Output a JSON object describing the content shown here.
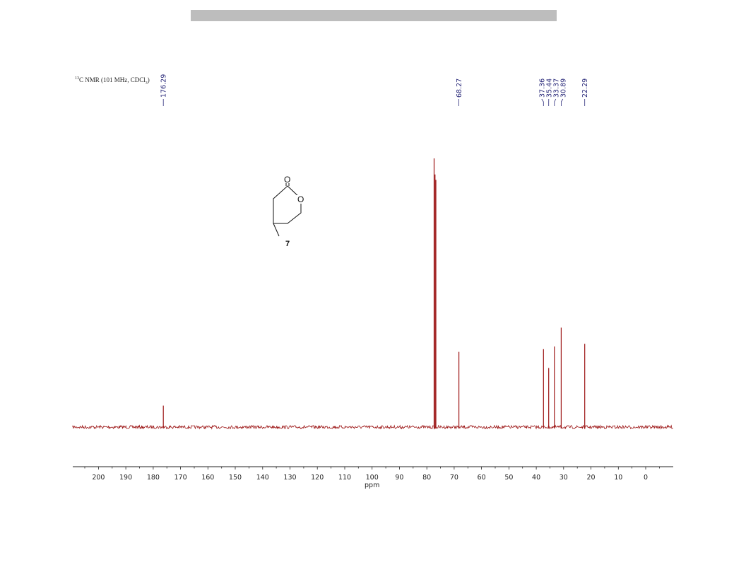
{
  "header": {
    "isotope": "13",
    "nmr_prefix": "C NMR (101 MHz, CDCl",
    "solvent_sub": "3",
    "nmr_suffix": ")"
  },
  "compound": {
    "number": "7",
    "atoms": [
      "O",
      "O"
    ]
  },
  "colors": {
    "spectrum": "#9c1515",
    "peak_label": "#2a2a7a",
    "top_bar": "#bdbdbd"
  },
  "chart_data": {
    "type": "line",
    "title": "",
    "xlabel": "ppm",
    "ylabel": "",
    "x_reversed": true,
    "xlim": [
      220,
      -10
    ],
    "ylim": [
      0,
      1
    ],
    "x_ticks": [
      {
        "value": 200,
        "label": "200"
      },
      {
        "value": 190,
        "label": "190"
      },
      {
        "value": 180,
        "label": "180"
      },
      {
        "value": 170,
        "label": "170"
      },
      {
        "value": 160,
        "label": "160"
      },
      {
        "value": 150,
        "label": "150"
      },
      {
        "value": 140,
        "label": "140"
      },
      {
        "value": 130,
        "label": "130"
      },
      {
        "value": 120,
        "label": "120"
      },
      {
        "value": 110,
        "label": "110"
      },
      {
        "value": 100,
        "label": "100"
      },
      {
        "value": 90,
        "label": "90"
      },
      {
        "value": 80,
        "label": "80"
      },
      {
        "value": 70,
        "label": "70"
      },
      {
        "value": 60,
        "label": "60"
      },
      {
        "value": 50,
        "label": "50"
      },
      {
        "value": 40,
        "label": "40"
      },
      {
        "value": 30,
        "label": "30"
      },
      {
        "value": 20,
        "label": "20"
      },
      {
        "value": 10,
        "label": "10"
      },
      {
        "value": 0,
        "label": "0"
      }
    ],
    "peaks": [
      {
        "ppm": 176.29,
        "intensity": 0.08
      },
      {
        "ppm": 77.32,
        "intensity": 1.0
      },
      {
        "ppm": 77.0,
        "intensity": 0.94
      },
      {
        "ppm": 76.68,
        "intensity": 0.92
      },
      {
        "ppm": 68.27,
        "intensity": 0.28
      },
      {
        "ppm": 37.36,
        "intensity": 0.29
      },
      {
        "ppm": 35.44,
        "intensity": 0.22
      },
      {
        "ppm": 33.37,
        "intensity": 0.3
      },
      {
        "ppm": 30.89,
        "intensity": 0.37
      },
      {
        "ppm": 22.29,
        "intensity": 0.31
      }
    ],
    "peak_labels": [
      {
        "ppm": 176.29,
        "text": "176.29"
      },
      {
        "ppm": 68.27,
        "text": "68.27"
      },
      {
        "ppm": 37.36,
        "text": "37.36"
      },
      {
        "ppm": 35.44,
        "text": "35.44"
      },
      {
        "ppm": 33.37,
        "text": "33.37"
      },
      {
        "ppm": 30.89,
        "text": "30.89"
      },
      {
        "ppm": 22.29,
        "text": "22.29"
      }
    ]
  }
}
